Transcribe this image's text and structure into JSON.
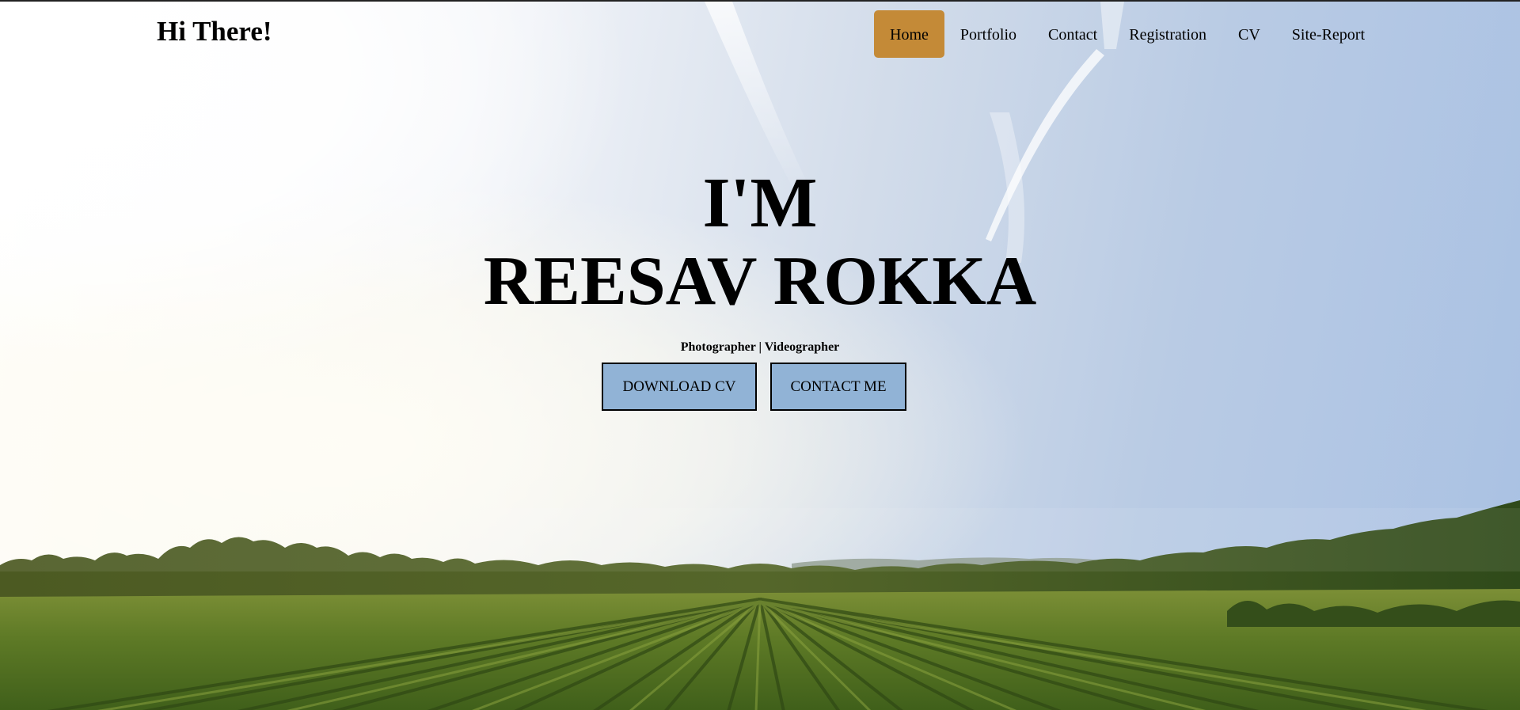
{
  "header": {
    "brand": "Hi There!",
    "nav": [
      {
        "label": "Home",
        "active": true
      },
      {
        "label": "Portfolio",
        "active": false
      },
      {
        "label": "Contact",
        "active": false
      },
      {
        "label": "Registration",
        "active": false
      },
      {
        "label": "CV",
        "active": false
      },
      {
        "label": "Site-Report",
        "active": false
      }
    ]
  },
  "hero": {
    "line1": "I'M",
    "line2": "REESAV ROKKA",
    "tagline": "Photographer | Videographer",
    "download_cv_label": "DOWNLOAD CV",
    "contact_me_label": "CONTACT ME"
  },
  "colors": {
    "nav_active_bg": "#c48a37",
    "button_bg": "#91b3d6",
    "text": "#000000"
  }
}
